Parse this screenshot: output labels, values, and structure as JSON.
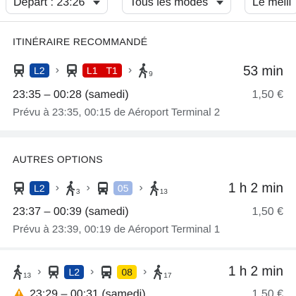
{
  "filters": {
    "departure": "Départ : 23:26",
    "modes": "Tous les modes",
    "best": "Le meill"
  },
  "recommended": {
    "title": "ITINÉRAIRE RECOMMANDÉ",
    "legs": [
      "L2",
      "L1",
      "T1"
    ],
    "walk_minutes": "9",
    "duration": "53 min",
    "times": "23:35 – 00:28 (samedi)",
    "price": "1,50 €",
    "detail": "Prévu à 23:35, 00:15 de Aéroport Terminal 2"
  },
  "other": {
    "title": "AUTRES OPTIONS",
    "option1": {
      "line1": "L2",
      "walk1": "3",
      "bus": "05",
      "walk2": "13",
      "duration": "1 h 2 min",
      "times": "23:37 – 00:39 (samedi)",
      "price": "1,50 €",
      "detail": "Prévu à 23:39, 00:19 de Aéroport Terminal 1"
    },
    "option2": {
      "walk1": "13",
      "line1": "L2",
      "bus": "08",
      "walk2": "17",
      "duration": "1 h 2 min",
      "times": "23:29 – 00:31 (samedi)",
      "price": "1,50 €"
    }
  },
  "colors": {
    "line_l2": "#0d47a1",
    "line_l1_t1": "#d50000",
    "bus_05": "#9fb7e6",
    "bus_08": "#ffd600"
  },
  "icons": [
    "train-icon",
    "chevron-right-icon",
    "walk-icon",
    "bus-icon",
    "warning-icon",
    "caret-down-icon"
  ]
}
